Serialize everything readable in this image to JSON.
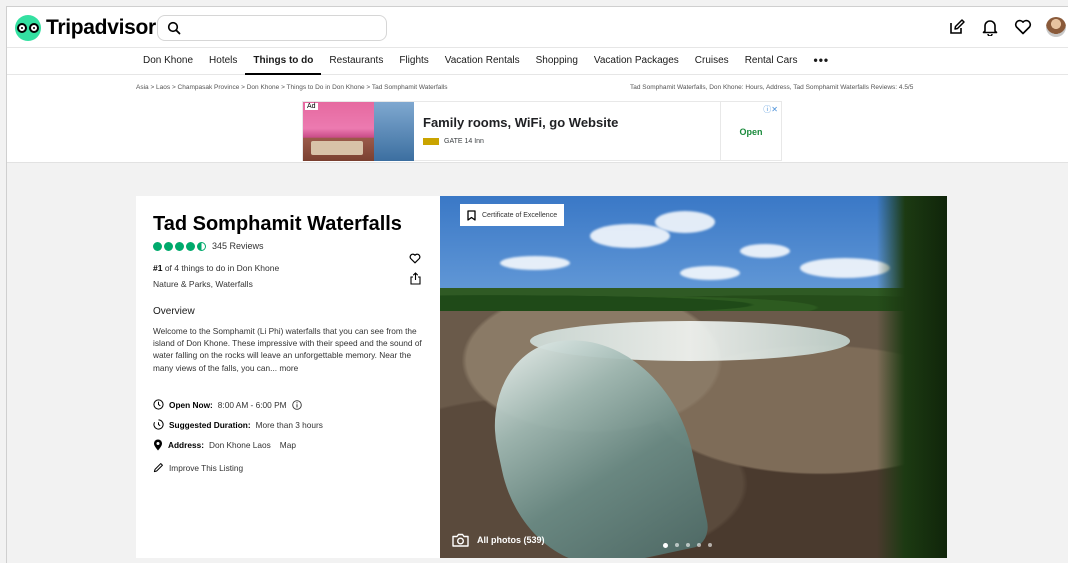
{
  "brand": {
    "name": "Tripadvisor"
  },
  "search": {
    "placeholder": ""
  },
  "header_icons": [
    "review-pencil-icon",
    "bell-icon",
    "heart-icon",
    "avatar"
  ],
  "nav": {
    "items": [
      "Don Khone",
      "Hotels",
      "Things to do",
      "Restaurants",
      "Flights",
      "Vacation Rentals",
      "Shopping",
      "Vacation Packages",
      "Cruises",
      "Rental Cars"
    ],
    "active": "Things to do",
    "more": "•••"
  },
  "breadcrumb": {
    "trail": "Asia > Laos > Champasak Province > Don Khone > Things to Do in Don Khone > Tad Somphamit Waterfalls",
    "right": "Tad Somphamit Waterfalls, Don Khone: Hours, Address, Tad Somphamit Waterfalls Reviews: 4.5/5"
  },
  "ad": {
    "tag": "Ad",
    "title": "Family rooms, WiFi, go Website",
    "advertiser": "GATE 14 Inn",
    "cta": "Open",
    "choices": "ⓘ✕"
  },
  "attraction": {
    "title": "Tad Somphamit Waterfalls",
    "rating_bubbles": 4.5,
    "reviews": "345 Reviews",
    "rank_bold": "#1",
    "rank_rest": " of 4 things to do in Don Khone",
    "categories": "Nature & Parks, Waterfalls",
    "overview_heading": "Overview",
    "overview_text": "Welcome to the Somphamit (Li Phi) waterfalls that you can see from the island of Don Khone. These impressive with their speed and the sound of water falling on the rocks will leave an unforgettable memory. Near the many views of the falls, you can...",
    "more_link": "more",
    "open_label": "Open Now:",
    "open_hours": "8:00 AM - 6:00 PM",
    "duration_label": "Suggested Duration:",
    "duration_value": "More than 3 hours",
    "address_label": "Address:",
    "address_value": "Don Khone Laos",
    "map_link": "Map",
    "improve_link": "Improve This Listing"
  },
  "photo": {
    "badge": "Certificate of Excellence",
    "all_photos": "All photos (539)",
    "carousel_total": 5,
    "carousel_active": 0
  }
}
